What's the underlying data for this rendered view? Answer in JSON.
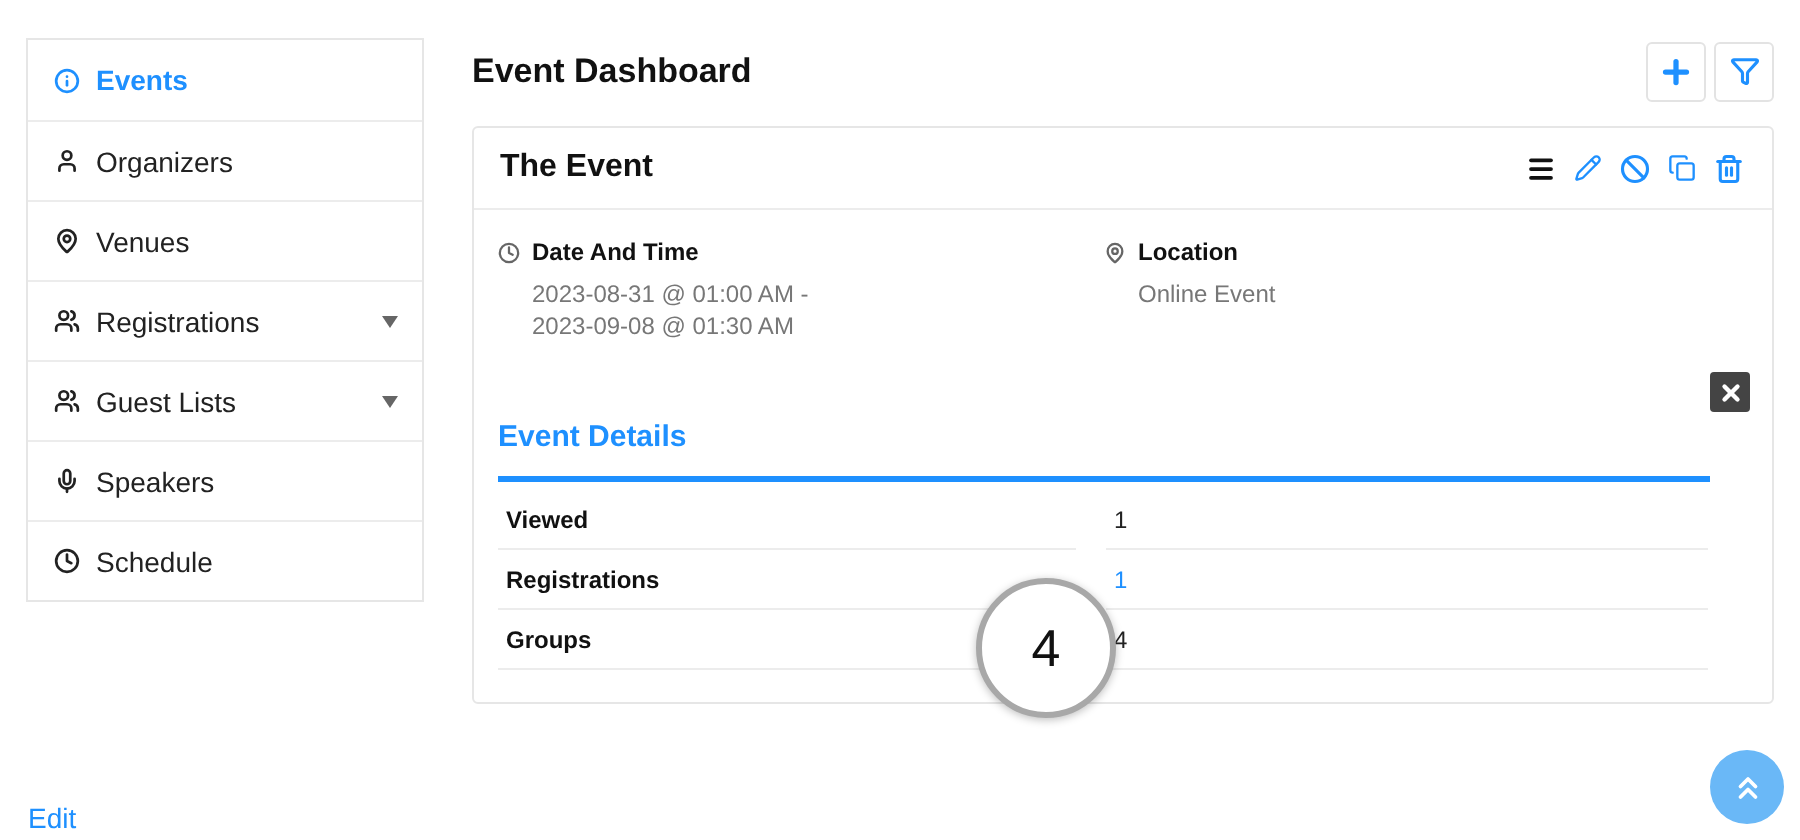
{
  "sidebar": {
    "items": [
      {
        "label": "Events",
        "selected": true,
        "has_submenu": false
      },
      {
        "label": "Organizers",
        "selected": false,
        "has_submenu": false
      },
      {
        "label": "Venues",
        "selected": false,
        "has_submenu": false
      },
      {
        "label": "Registrations",
        "selected": false,
        "has_submenu": true
      },
      {
        "label": "Guest Lists",
        "selected": false,
        "has_submenu": true
      },
      {
        "label": "Speakers",
        "selected": false,
        "has_submenu": false
      },
      {
        "label": "Schedule",
        "selected": false,
        "has_submenu": false
      }
    ]
  },
  "page_title": "Event Dashboard",
  "event": {
    "title": "The Event",
    "date_label": "Date And Time",
    "date_lines": [
      "2023-08-31 @ 01:00 AM -",
      "2023-09-08 @ 01:30 AM"
    ],
    "location_label": "Location",
    "location": "Online Event",
    "details_title": "Event Details",
    "details": [
      {
        "label": "Viewed",
        "value": "1",
        "linked": false
      },
      {
        "label": "Registrations",
        "value": "1",
        "linked": true
      },
      {
        "label": "Groups",
        "value": "4",
        "linked": false
      }
    ]
  },
  "callout": "4",
  "edit_link": "Edit"
}
